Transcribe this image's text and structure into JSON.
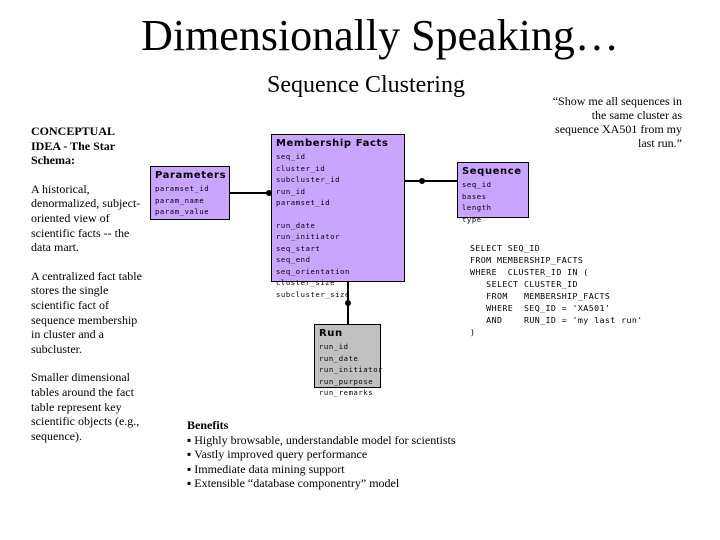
{
  "title": "Dimensionally Speaking…",
  "subtitle": "Sequence Clustering",
  "left_column": {
    "heading": "CONCEPTUAL IDEA - The Star Schema:",
    "paragraphs": [
      "A historical, denormalized, subject-oriented view of scientific facts -- the data mart.",
      "A centralized fact table stores the single scientific fact of sequence membership in cluster and a subcluster.",
      "Smaller dimensional tables around the fact table represent key scientific objects (e.g., sequence)."
    ]
  },
  "quote": "“Show me all sequences in the same cluster as sequence XA501 from my last run.”",
  "entities": {
    "facts": {
      "name": "Membership Facts",
      "keys": [
        "seq_id",
        "cluster_id",
        "subcluster_id",
        "run_id",
        "paramset_id"
      ],
      "attributes": [
        "run_date",
        "run_initiator",
        "seq_start",
        "seq_end",
        "seq_orientation",
        "cluster_size",
        "subcluster_size"
      ]
    },
    "parameters": {
      "name": "Parameters",
      "fields": [
        "paramset_id",
        "param_name",
        "param_value"
      ]
    },
    "sequence": {
      "name": "Sequence",
      "fields": [
        "seq_id",
        "bases",
        "length",
        "type"
      ]
    },
    "run": {
      "name": "Run",
      "fields": [
        "run_id",
        "run_date",
        "run_initiator",
        "run_purpose",
        "run_remarks"
      ]
    }
  },
  "colors": {
    "dimension_fill": "#c9a5ff",
    "run_fill": "#c0c0c0"
  },
  "sql": [
    "SELECT SEQ_ID",
    "FROM MEMBERSHIP_FACTS",
    "WHERE  CLUSTER_ID IN (",
    "   SELECT CLUSTER_ID",
    "   FROM   MEMBERSHIP_FACTS",
    "   WHERE  SEQ_ID = 'XA501'",
    "   AND    RUN_ID = 'my last run'",
    ")"
  ],
  "benefits": {
    "heading": "Benefits",
    "items": [
      "Highly browsable, understandable model for scientists",
      "Vastly improved query performance",
      "Immediate data mining support",
      "Extensible “database componentry” model"
    ]
  }
}
